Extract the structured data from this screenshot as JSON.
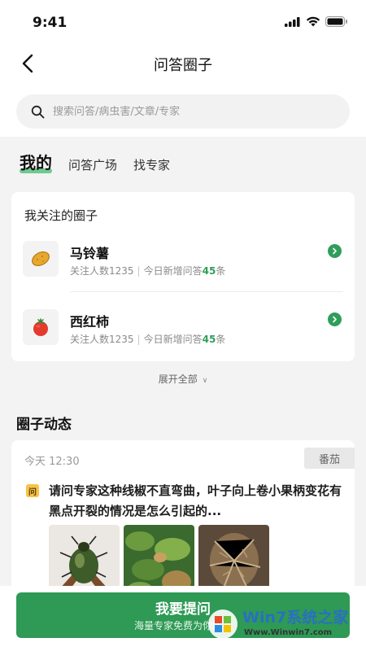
{
  "status_bar": {
    "time": "9:41"
  },
  "nav": {
    "title": "问答圈子"
  },
  "search": {
    "placeholder": "搜索问答/病虫害/文章/专家"
  },
  "tabs": [
    {
      "label": "我的",
      "active": true
    },
    {
      "label": "问答广场",
      "active": false
    },
    {
      "label": "找专家",
      "active": false
    }
  ],
  "follow": {
    "title": "我关注的圈子",
    "items": [
      {
        "name": "马铃薯",
        "followers": "关注人数1235",
        "today_prefix": "今日新增问答",
        "today_count": "45",
        "today_suffix": "条",
        "icon": "potato-icon"
      },
      {
        "name": "西红柿",
        "followers": "关注人数1235",
        "today_prefix": "今日新增问答",
        "today_count": "45",
        "today_suffix": "条",
        "icon": "tomato-icon"
      }
    ]
  },
  "expand_label": "展开全部",
  "feed": {
    "section_title": "圈子动态",
    "post": {
      "time": "今天 12:30",
      "tag": "番茄",
      "badge": "问",
      "text": "请问专家这种线椒不直弯曲，叶子向上卷小果柄变花有黑点开裂的情况是怎么引起的..."
    }
  },
  "bottom": {
    "ask_label": "我要提问",
    "ask_sub": "海量专家免费为你解答"
  },
  "watermark": {
    "brand": "Win7系统之家",
    "url": "Www.Winwin7.com"
  },
  "colors": {
    "primary": "#2e9a55",
    "accent": "#2f9e5b",
    "badge": "#f6c34a"
  }
}
